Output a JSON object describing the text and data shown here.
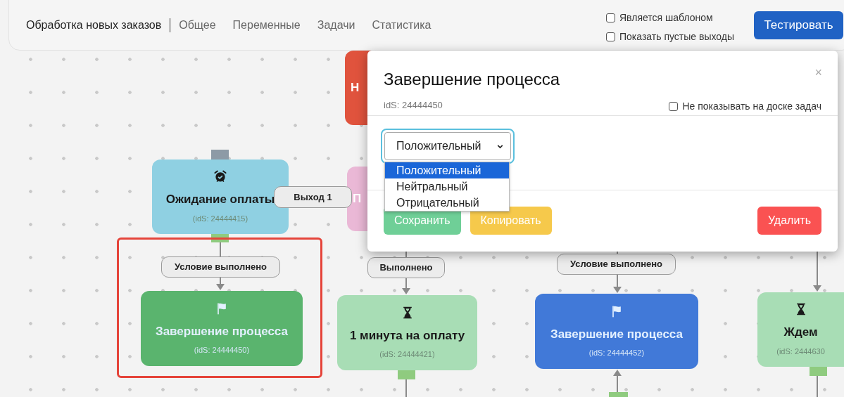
{
  "header": {
    "title": "Обработка новых заказов",
    "tabs": [
      {
        "label": "Общее",
        "selected": false
      },
      {
        "label": "Переменные",
        "selected": false
      },
      {
        "label": "Задачи",
        "selected": false
      },
      {
        "label": "Статистика",
        "selected": false
      }
    ],
    "options": [
      {
        "label": "Является шаблоном",
        "checked": false
      },
      {
        "label": "Показать пустые выходы",
        "checked": false
      }
    ],
    "test_button": "Тестировать"
  },
  "nodes": [
    {
      "kind": "cut",
      "title": "Н",
      "color": "#e0533d",
      "highlighted": false
    },
    {
      "kind": "timer",
      "title": "Ожидание оплаты",
      "ids": "(idS: 24444415)",
      "color": "#8fd0e2",
      "highlighted": false
    },
    {
      "kind": "cut",
      "title": "П",
      "color": "#eab8d6",
      "highlighted": false
    },
    {
      "kind": "finish",
      "title": "Завершение процесса",
      "ids": "(idS: 24444450)",
      "color": "#5ab46e",
      "highlighted": true
    },
    {
      "kind": "wait",
      "title": "1 минута на оплату",
      "ids": "(idS: 24444421)",
      "color": "#a8ddb5",
      "highlighted": false
    },
    {
      "kind": "finish",
      "title": "Завершение процесса",
      "ids": "(idS: 24444452)",
      "color": "#4179d8",
      "highlighted": false
    },
    {
      "kind": "wait",
      "title": "Ждем",
      "ids": "(idS: 2444630",
      "color": "#a8ddb5",
      "highlighted": false
    }
  ],
  "edge_labels": [
    "Выход 1",
    "Условие выполнено",
    "Выполнено",
    "Условие выполнено"
  ],
  "modal": {
    "title": "Завершение процесса",
    "ids": "idS: 24444450",
    "hide_option": {
      "label": "Не показывать на доске задач",
      "checked": false
    },
    "select": {
      "value": "Положительный",
      "expanded": true,
      "options": [
        {
          "label": "Положительный",
          "selected": true
        },
        {
          "label": "Нейтральный",
          "selected": false
        },
        {
          "label": "Отрицательный",
          "selected": false
        }
      ]
    },
    "close": "×",
    "buttons": [
      {
        "kind": "save",
        "label": "Сохранить"
      },
      {
        "kind": "copy",
        "label": "Копировать"
      },
      {
        "kind": "delete",
        "label": "Удалить"
      }
    ]
  }
}
